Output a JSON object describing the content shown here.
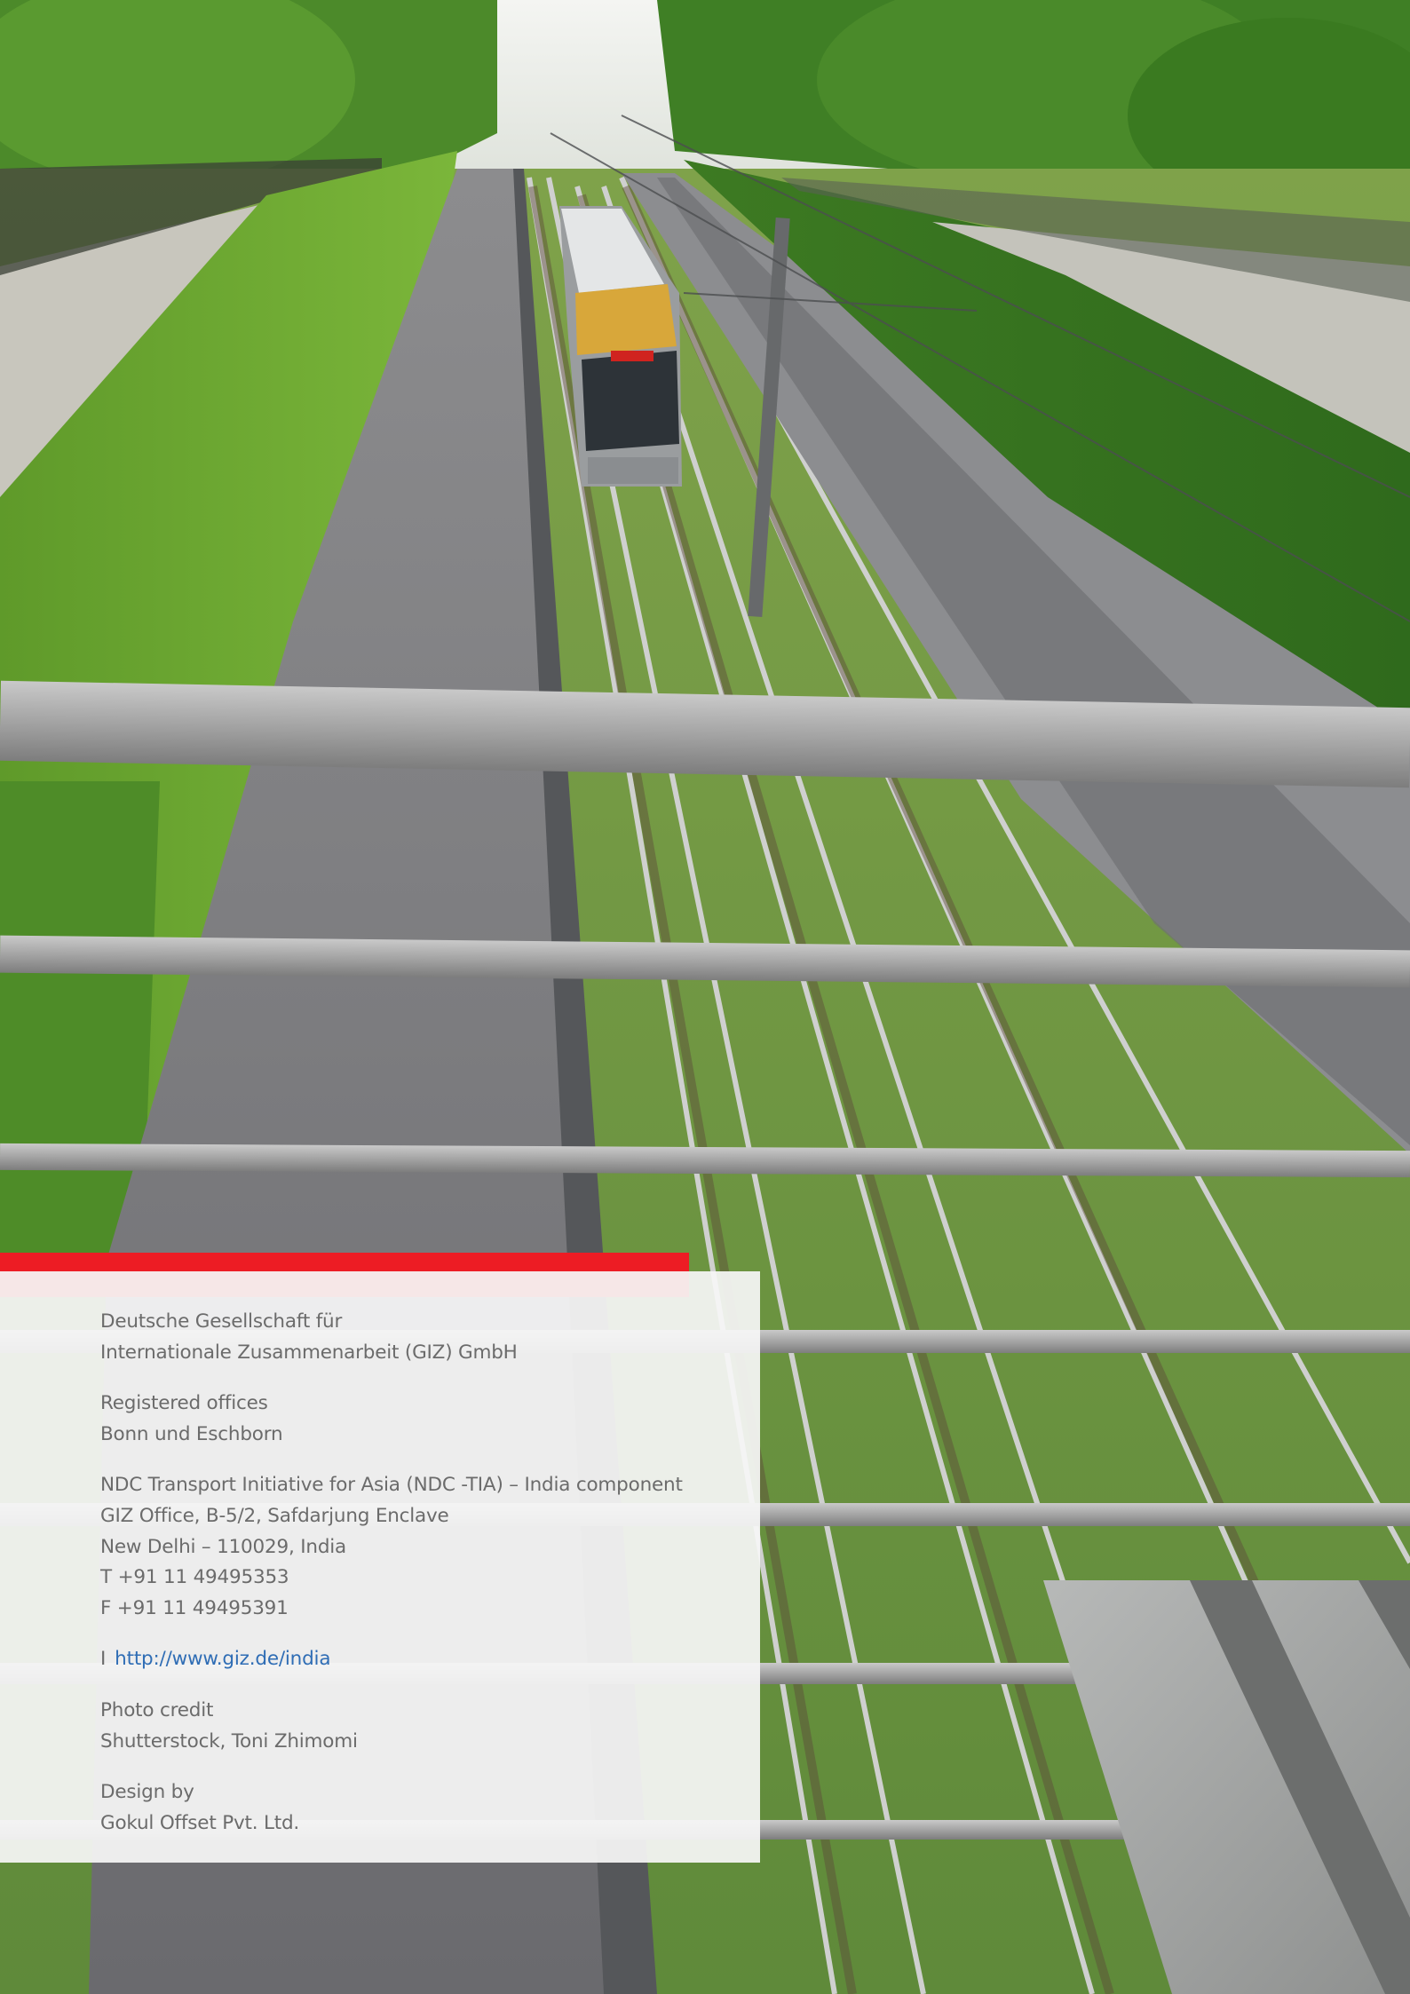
{
  "colors": {
    "accent_red": "#ED1C24",
    "link_blue": "#2F6DB5",
    "text_gray": "#6B6B6B",
    "panel_white": "#F6F6F6"
  },
  "background": {
    "photo_subject": "tram-on-grass-tracks-viewed-from-bridge"
  },
  "imprint": {
    "publisher": {
      "line1": "Deutsche Gesellschaft für",
      "line2": "Internationale Zusammenarbeit (GIZ) GmbH"
    },
    "offices": {
      "line1": "Registered offices",
      "line2": "Bonn und Eschborn"
    },
    "address": {
      "line1": "NDC Transport Initiative for Asia (NDC -TIA) – India component",
      "line2": "GIZ Office, B-5/2, Safdarjung Enclave",
      "line3": "New Delhi – 110029, India",
      "phone": "T  +91 11 49495353",
      "fax": "F  +91 11 49495391"
    },
    "web": {
      "prefix": "I",
      "url": "http://www.giz.de/india"
    },
    "photo_credit": {
      "label": "Photo credit",
      "value": "Shutterstock, Toni Zhimomi"
    },
    "design": {
      "label": "Design by",
      "value": "Gokul Offset Pvt. Ltd."
    }
  }
}
